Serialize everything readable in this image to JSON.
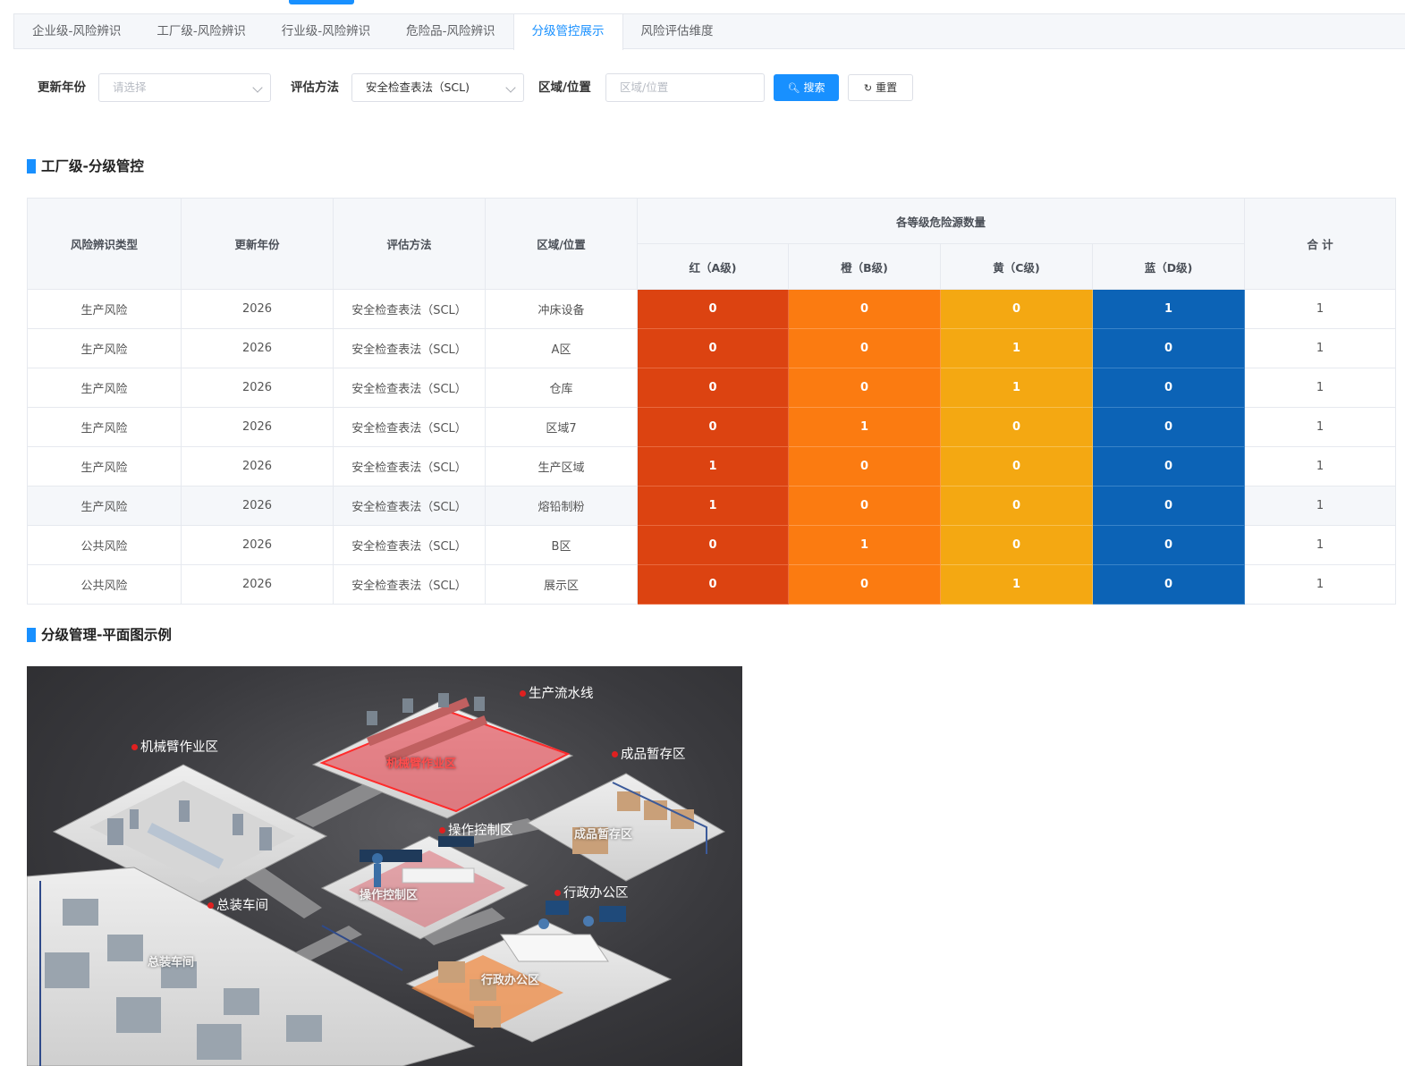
{
  "tabs": [
    {
      "label": "企业级-风险辨识"
    },
    {
      "label": "工厂级-风险辨识"
    },
    {
      "label": "行业级-风险辨识"
    },
    {
      "label": "危险品-风险辨识"
    },
    {
      "label": "分级管控展示"
    },
    {
      "label": "风险评估维度"
    }
  ],
  "active_tab": "分级管控展示",
  "filters": {
    "year_label": "更新年份",
    "year_placeholder": "请选择",
    "method_label": "评估方法",
    "method_value": "安全检查表法（SCL)",
    "area_label": "区域/位置",
    "area_placeholder": "区域/位置",
    "search_label": "搜索",
    "reset_label": "重置"
  },
  "section1_title": "工厂级-分级管控",
  "section2_title": "分级管理-平面图示例",
  "table": {
    "headers": {
      "type": "风险辨识类型",
      "year": "更新年份",
      "method": "评估方法",
      "area": "区域/位置",
      "group": "各等级危险源数量",
      "red": "红（A级)",
      "orange": "橙（B级)",
      "yellow": "黄（C级)",
      "blue": "蓝（D级)",
      "total": "合 计"
    },
    "rows": [
      {
        "type": "生产风险",
        "year": "2026",
        "method": "安全检查表法（SCL）",
        "area": "冲床设备",
        "red": "0",
        "orange": "0",
        "yellow": "0",
        "blue": "1",
        "total": "1"
      },
      {
        "type": "生产风险",
        "year": "2026",
        "method": "安全检查表法（SCL）",
        "area": "A区",
        "red": "0",
        "orange": "0",
        "yellow": "1",
        "blue": "0",
        "total": "1"
      },
      {
        "type": "生产风险",
        "year": "2026",
        "method": "安全检查表法（SCL）",
        "area": "仓库",
        "red": "0",
        "orange": "0",
        "yellow": "1",
        "blue": "0",
        "total": "1"
      },
      {
        "type": "生产风险",
        "year": "2026",
        "method": "安全检查表法（SCL）",
        "area": "区域7",
        "red": "0",
        "orange": "1",
        "yellow": "0",
        "blue": "0",
        "total": "1"
      },
      {
        "type": "生产风险",
        "year": "2026",
        "method": "安全检查表法（SCL）",
        "area": "生产区域",
        "red": "1",
        "orange": "0",
        "yellow": "0",
        "blue": "0",
        "total": "1"
      },
      {
        "type": "生产风险",
        "year": "2026",
        "method": "安全检查表法（SCL）",
        "area": "熔铅制粉",
        "red": "1",
        "orange": "0",
        "yellow": "0",
        "blue": "0",
        "total": "1"
      },
      {
        "type": "公共风险",
        "year": "2026",
        "method": "安全检查表法（SCL）",
        "area": "B区",
        "red": "0",
        "orange": "1",
        "yellow": "0",
        "blue": "0",
        "total": "1"
      },
      {
        "type": "公共风险",
        "year": "2026",
        "method": "安全检查表法（SCL）",
        "area": "展示区",
        "red": "0",
        "orange": "0",
        "yellow": "1",
        "blue": "0",
        "total": "1"
      }
    ]
  },
  "plan_labels": {
    "production_line": "生产流水线",
    "robot_arm_zone": "机械臂作业区",
    "finished_storage": "成品暂存区",
    "control_zone": "操作控制区",
    "admin_office": "行政办公区",
    "assembly_workshop": "总装车间"
  },
  "colors": {
    "accent": "#1890ff",
    "level_red": "#dc4311",
    "level_orange": "#fb7b11",
    "level_yellow": "#f4a812",
    "level_blue": "#0c63b6"
  }
}
